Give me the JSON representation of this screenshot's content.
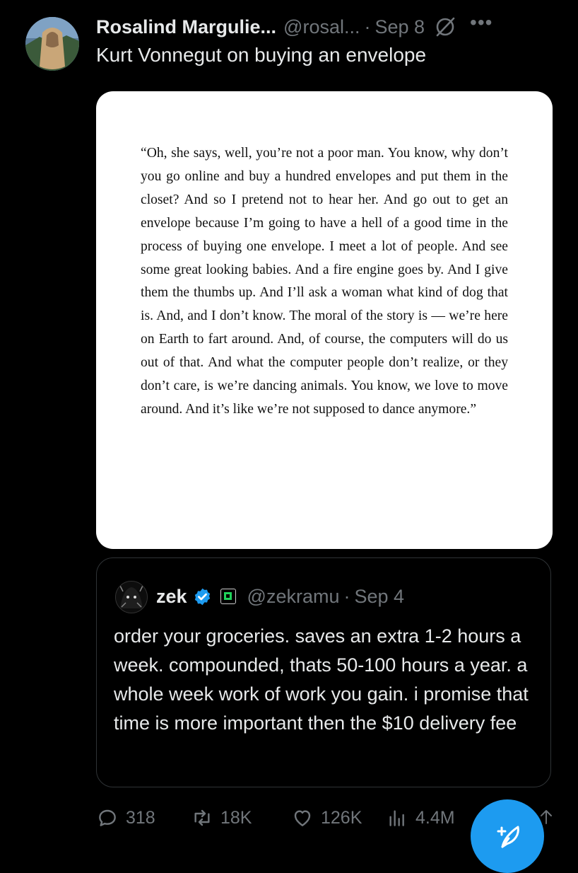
{
  "tweet": {
    "author_name": "Rosalind Margulie...",
    "author_handle": "@rosal...",
    "separator": "·",
    "date": "Sep 8",
    "text": "Kurt Vonnegut on buying an envelope",
    "media_quote": "“Oh, she says, well, you’re not a poor man. You know, why don’t you go online and buy a hundred envelopes and put them in the closet? And so I pretend not to hear her. And go out to get an envelope because I’m going to have a hell of a good time in the process of buying one envelope. I meet a lot of people. And see some great looking babies. And a fire engine goes by. And I give them the thumbs up. And I’ll ask a woman what kind of dog that is. And, and I don’t know. The moral of the story is — we’re here on Earth to fart around. And, of course, the computers will do us out of that. And what the computer people don’t realize, or they don’t care, is we’re dancing animals. You know, we love to move around. And it’s like we’re not supposed to dance anymore.”"
  },
  "quoted_tweet": {
    "author_name": "zek",
    "author_handle": "@zekramu",
    "separator": "·",
    "date": "Sep 4",
    "text": "order your groceries. saves an extra 1-2 hours a week. compounded, thats 50-100 hours a year. a whole week work of work you gain. i promise that time is more important then the $10 delivery fee"
  },
  "actions": {
    "replies": "318",
    "reposts": "18K",
    "likes": "126K",
    "views": "4.4M"
  },
  "icons": [
    "grok-icon",
    "more-icon",
    "verified-icon",
    "affiliate-icon",
    "reply-icon",
    "repost-icon",
    "like-icon",
    "views-icon",
    "compose-icon",
    "share-icon"
  ],
  "colors": {
    "accent": "#1d9bf0",
    "muted": "#71767b",
    "text": "#e7e9ea",
    "background": "#000000"
  }
}
